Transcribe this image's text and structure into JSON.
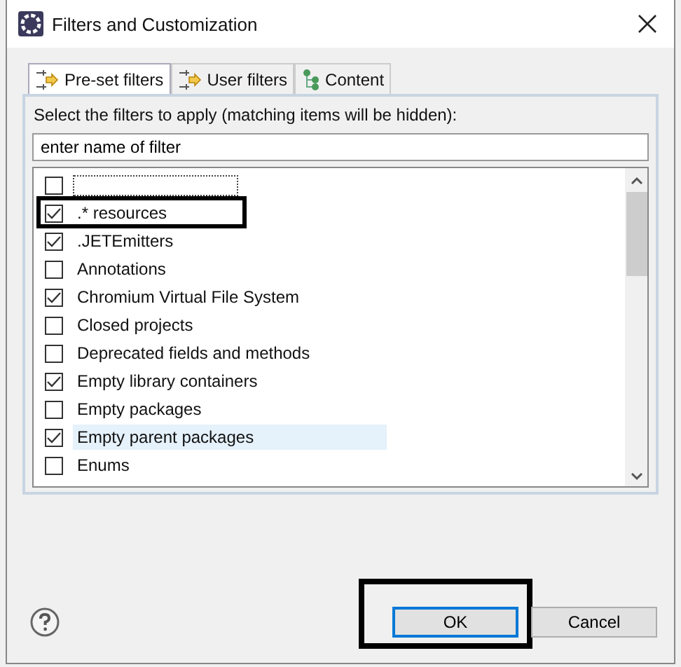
{
  "window": {
    "title": "Filters and Customization"
  },
  "tabs": [
    {
      "label": "Pre-set filters",
      "selected": true,
      "kind": "filter"
    },
    {
      "label": "User filters",
      "selected": false,
      "kind": "filter"
    },
    {
      "label": "Content",
      "selected": false,
      "kind": "tree"
    }
  ],
  "instruction": "Select the filters to apply (matching items will be hidden):",
  "search": {
    "value": "enter name of filter"
  },
  "filters": [
    {
      "checked": false,
      "focused": true,
      "highlighted": false
    },
    {
      "label": ".* resources",
      "checked": true,
      "highlighted": true
    },
    {
      "label": ".JETEmitters",
      "checked": true
    },
    {
      "label": "Annotations",
      "checked": false
    },
    {
      "label": "Chromium Virtual File System",
      "checked": true
    },
    {
      "label": "Closed projects",
      "checked": false
    },
    {
      "label": "Deprecated fields and methods",
      "checked": false
    },
    {
      "label": "Empty library containers",
      "checked": true
    },
    {
      "label": "Empty packages",
      "checked": false
    },
    {
      "label": "Empty parent packages",
      "checked": true,
      "hovered": true
    },
    {
      "label": "Enums",
      "checked": false
    }
  ],
  "buttons": [
    {
      "label": "OK",
      "default": true,
      "highlighted": true
    },
    {
      "label": "Cancel",
      "default": false,
      "highlighted": false
    }
  ]
}
